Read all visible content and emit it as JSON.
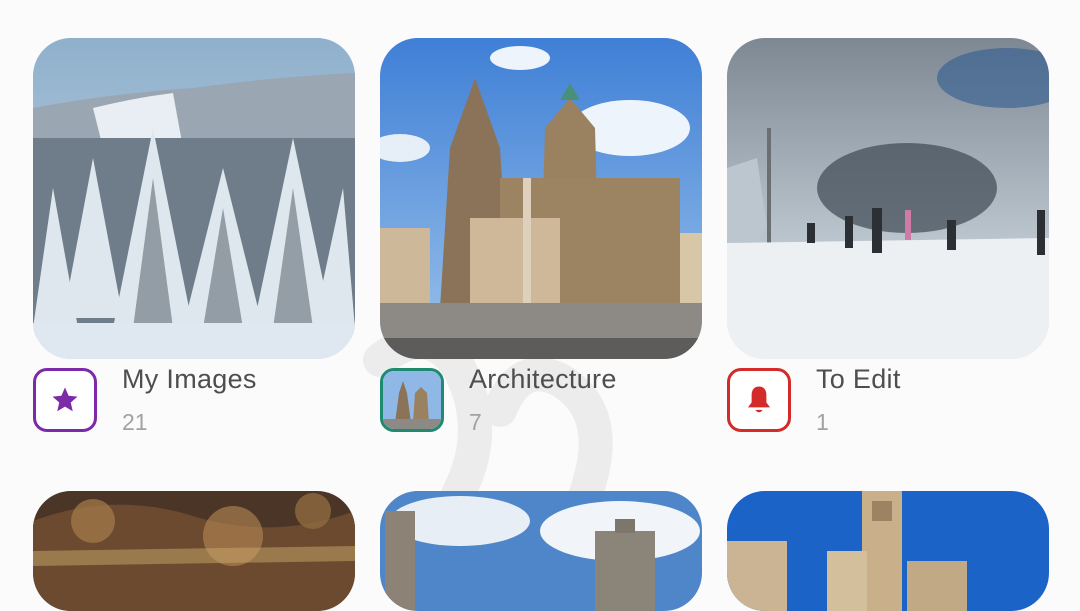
{
  "albums": [
    {
      "title": "My Images",
      "count": "21",
      "icon": "star-icon",
      "accent": "#7b2aa8"
    },
    {
      "title": "Architecture",
      "count": "7",
      "icon": "album-cover-thumbnail",
      "accent": "#1e8a6f"
    },
    {
      "title": "To Edit",
      "count": "1",
      "icon": "bell-icon",
      "accent": "#d32a2a"
    }
  ],
  "next_row": [
    {
      "icon": "baroque-ceiling-photo"
    },
    {
      "icon": "clouds-building-photo"
    },
    {
      "icon": "church-tower-photo"
    }
  ]
}
